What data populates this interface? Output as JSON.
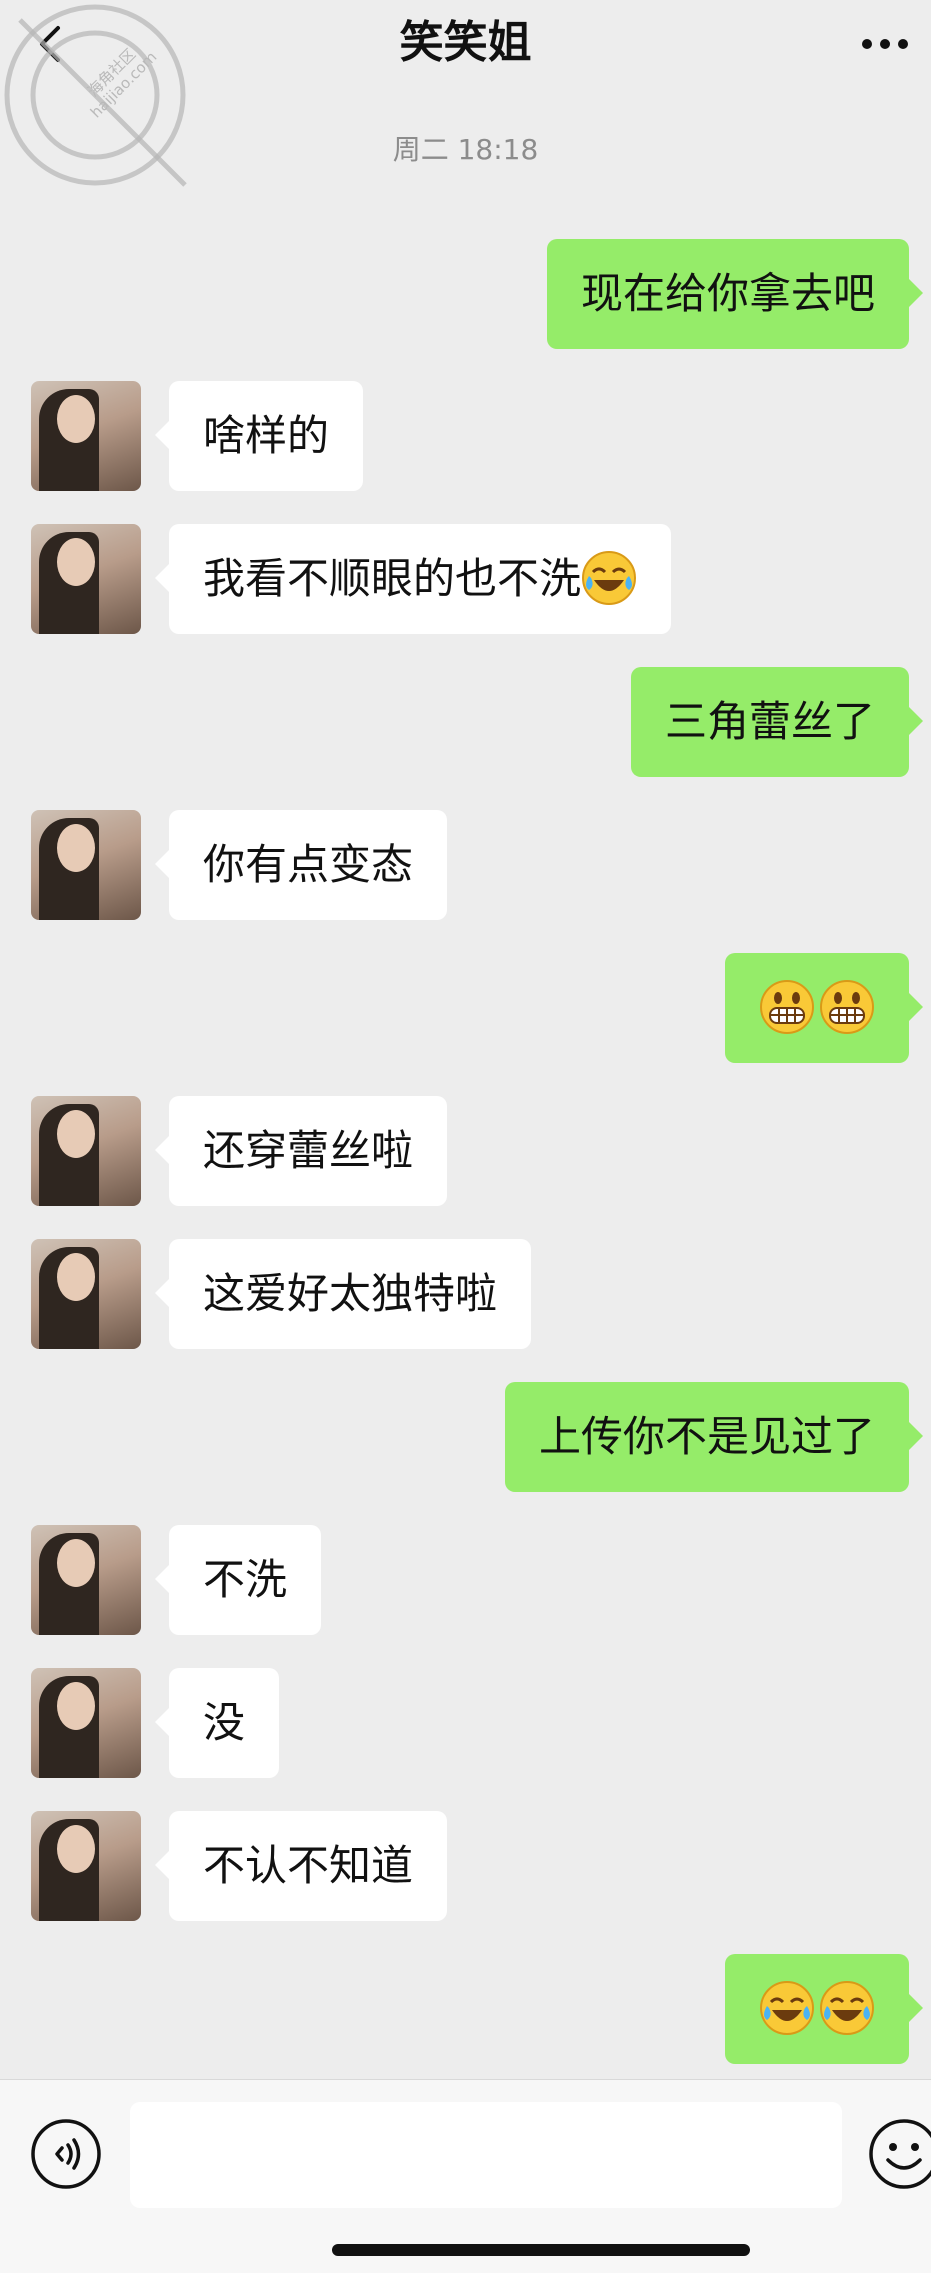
{
  "header": {
    "title": "笑笑姐"
  },
  "watermark": {
    "text": "海角社区 haijiao.com"
  },
  "timestamp": "周二 18:18",
  "messages": [
    {
      "side": "out",
      "text": "现在给你拿去吧"
    },
    {
      "side": "in",
      "text": "啥样的"
    },
    {
      "side": "in",
      "text": "我看不顺眼的也不洗",
      "emoji": [
        "crying-laughing"
      ]
    },
    {
      "side": "out",
      "text": "三角蕾丝了"
    },
    {
      "side": "in",
      "text": "你有点变态"
    },
    {
      "side": "out",
      "text": "",
      "emoji": [
        "grinning",
        "grinning"
      ]
    },
    {
      "side": "in",
      "text": "还穿蕾丝啦"
    },
    {
      "side": "in",
      "text": "这爱好太独特啦"
    },
    {
      "side": "out",
      "text": "上传你不是见过了"
    },
    {
      "side": "in",
      "text": "不洗"
    },
    {
      "side": "in",
      "text": "没"
    },
    {
      "side": "in",
      "text": "不认不知道"
    },
    {
      "side": "out",
      "text": "",
      "emoji": [
        "crying-laughing",
        "crying-laughing"
      ]
    }
  ],
  "input": {
    "value": "",
    "placeholder": ""
  },
  "colors": {
    "background": "#ededed",
    "outgoing_bubble": "#95ec69",
    "incoming_bubble": "#ffffff"
  },
  "icons": {
    "back": "back-arrow-icon",
    "more": "more-dots-icon",
    "voice": "voice-icon",
    "emoji": "emoji-icon"
  }
}
